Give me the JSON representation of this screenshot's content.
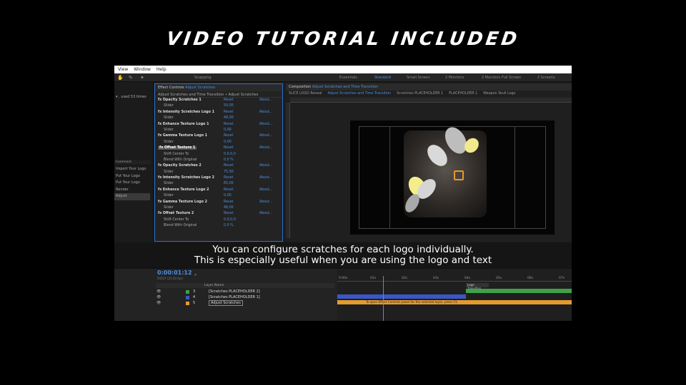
{
  "banner": {
    "title": "VIDEO TUTORIAL INCLUDED"
  },
  "menu": {
    "items": [
      "View",
      "Window",
      "Help"
    ]
  },
  "toolbar": {
    "snapping": "Snapping",
    "workspaces": [
      "Essentials",
      "Standard",
      "Small Screen",
      "2 Monitors",
      "2 Monitors Full Screen",
      "2 Screens"
    ],
    "active_workspace": "Standard"
  },
  "project": {
    "used_text": "▾ , used 53 times",
    "comment_header": "Comment",
    "effects": [
      "Import Your Logo",
      "Put Your Logo",
      "Put Your Logo",
      "Render",
      "Adjust"
    ],
    "selected_index": 4
  },
  "effect_controls": {
    "tab_prefix": "Effect Controls",
    "tab_layer": "Adjust Scratches",
    "breadcrumb": "Adjust Scratches and Time Transition • Adjust Scratches",
    "reset_label": "Reset",
    "about_label": "About...",
    "rows": [
      {
        "name": "fx Opacity Scratches 1",
        "kind": "effect"
      },
      {
        "name": "Slider",
        "kind": "sub",
        "value": "50,00"
      },
      {
        "name": "fx Intensity Scratches Logo 1",
        "kind": "effect"
      },
      {
        "name": "Slider",
        "kind": "sub",
        "value": "48,00"
      },
      {
        "name": "fx Enhance Texture Logo 1",
        "kind": "effect"
      },
      {
        "name": "Slider",
        "kind": "sub",
        "value": "0,00"
      },
      {
        "name": "fx Gamma Texture Logo 1",
        "kind": "effect"
      },
      {
        "name": "Slider",
        "kind": "sub",
        "value": "0,00"
      },
      {
        "name": "fx Offset Texture 1",
        "kind": "effect",
        "highlight": true
      },
      {
        "name": "Shift Center To",
        "kind": "sub",
        "value": "0,0,0,0"
      },
      {
        "name": "Blend With Original",
        "kind": "sub",
        "value": "0,0 %"
      },
      {
        "name": "fx Opacity Scratches 2",
        "kind": "effect"
      },
      {
        "name": "Slider",
        "kind": "sub",
        "value": "75,00"
      },
      {
        "name": "fx Intensity Scratches Logo 2",
        "kind": "effect"
      },
      {
        "name": "Slider",
        "kind": "sub",
        "value": "65,00"
      },
      {
        "name": "fx Enhance Texture Logo 2",
        "kind": "effect"
      },
      {
        "name": "Slider",
        "kind": "sub",
        "value": "0,00"
      },
      {
        "name": "fx Gamma Texture Logo 2",
        "kind": "effect"
      },
      {
        "name": "Slider",
        "kind": "sub",
        "value": "48,00"
      },
      {
        "name": "fx Offset Texture 2",
        "kind": "effect"
      },
      {
        "name": "Shift Center To",
        "kind": "sub",
        "value": "0,0,0,0"
      },
      {
        "name": "Blend With Original",
        "kind": "sub",
        "value": "0,0 %"
      }
    ]
  },
  "composition": {
    "tab_prefix": "Composition",
    "tab_comp": "Adjust Scratches and Time Transition",
    "crumbs": [
      "SLICE LOGO Reveal",
      "Adjust Scratches and Time Transition",
      "Scratches PLACEHOLDER 1",
      "PLACEHOLDER 1",
      "Weapon Skull Logo"
    ],
    "active_crumb": 1
  },
  "subtitles": {
    "line1": "You can configure scratches for each logo individually.",
    "line2": "This is especially useful when you are using the logo and text"
  },
  "timeline": {
    "timecode": "0:00:01:12",
    "timecode_sub": "00037 (25.00 fps)",
    "layer_name_header": "Layer Name",
    "layers": [
      {
        "num": "3",
        "name": "[Scratches PLACEHOLDER 2]",
        "color": "#3fa14a"
      },
      {
        "num": "4",
        "name": "[Scratches PLACEHOLDER 1]",
        "color": "#3a57c9"
      },
      {
        "num": "5",
        "name": "Adjust Scratches",
        "color": "#e49b2d",
        "selected": true
      }
    ],
    "ticks": [
      "0:00s",
      "01s",
      "02s",
      "03s",
      "04s",
      "05s",
      "06s",
      "07s"
    ],
    "marker": "Logo Transition",
    "hint": "To open Effect Controls panel for the selected layer, press F3."
  }
}
